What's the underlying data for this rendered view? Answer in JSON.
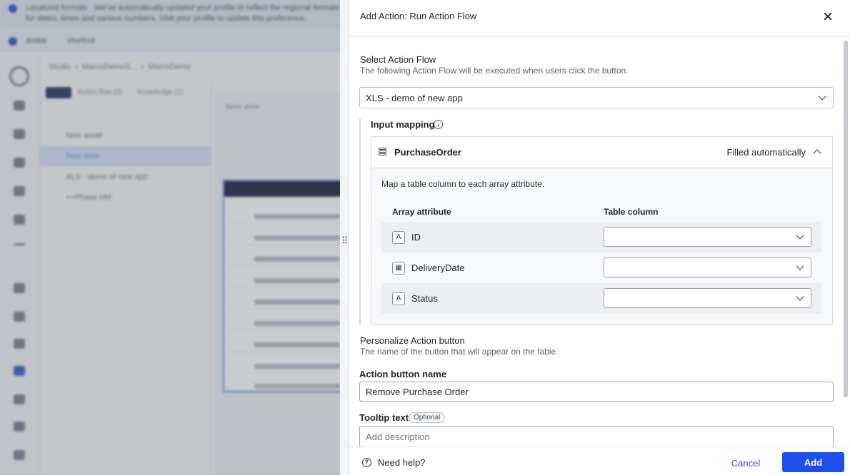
{
  "background": {
    "banner_text": "Localized formats · We've automatically updated your profile to reflect the regional formats for dates, times and various numbers. Visit your profile to update this preference.",
    "user_chips": [
      "avatar",
      "shortcut"
    ],
    "breadcrumb": [
      "Studio",
      "MarcoDemoS...",
      "MarcoDemo"
    ],
    "left_tabs": [
      "XLS",
      "Action flow (3)",
      "Knowledge (1)"
    ],
    "left_items": [
      "New asset",
      "New view",
      "XLS - demo of new app",
      "++Phase HM"
    ],
    "canvas_tab": "New view"
  },
  "dialog": {
    "title": "Add Action: Run Action Flow",
    "close_icon": "close-icon",
    "action_flow": {
      "label": "Select Action Flow",
      "description": "The following Action Flow will be executed when users click the button.",
      "selected": "XLS - demo of new app"
    },
    "input_mapping": {
      "label": "Input mapping",
      "entity": {
        "name": "PurchaseOrder",
        "status": "Filled automatically",
        "hint": "Map a table column to each array attribute.",
        "col_attribute": "Array attribute",
        "col_table": "Table column",
        "rows": [
          {
            "name": "ID",
            "icon": "text-type-icon",
            "glyph": "A",
            "value": ""
          },
          {
            "name": "DeliveryDate",
            "icon": "calendar-icon",
            "glyph": "▦",
            "value": ""
          },
          {
            "name": "Status",
            "icon": "text-type-icon",
            "glyph": "A",
            "value": ""
          }
        ]
      }
    },
    "personalize": {
      "label": "Personalize Action button",
      "description": "The name of the button that will appear on the table.",
      "button_name_label": "Action button name",
      "button_name_value": "Remove Purchase Order",
      "tooltip_label": "Tooltip text",
      "optional_badge": "Optional",
      "tooltip_placeholder": "Add description"
    },
    "footer": {
      "help": "Need help?",
      "cancel": "Cancel",
      "add": "Add"
    }
  }
}
